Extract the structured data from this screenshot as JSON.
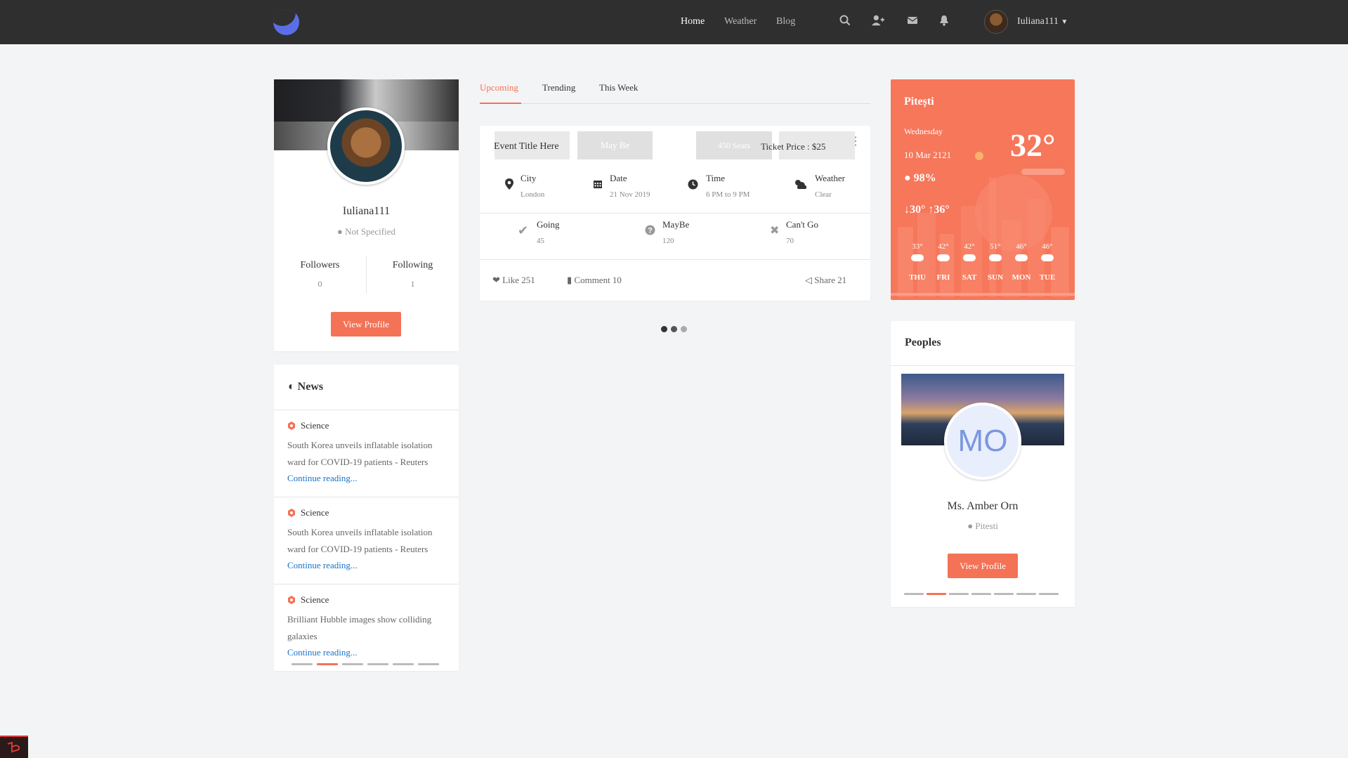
{
  "nav": {
    "links": [
      "Home",
      "Weather",
      "Blog"
    ],
    "user": "Iuliana111"
  },
  "profile": {
    "name": "Iuliana111",
    "location": "Not Specified",
    "followers_label": "Followers",
    "followers": "0",
    "following_label": "Following",
    "following": "1",
    "button": "View Profile"
  },
  "news": {
    "title": "News",
    "items": [
      {
        "category": "Science",
        "text": "South Korea unveils inflatable isolation ward for COVID-19 patients - Reuters",
        "link": "Continue reading..."
      },
      {
        "category": "Science",
        "text": "South Korea unveils inflatable isolation ward for COVID-19 patients - Reuters",
        "link": "Continue reading..."
      },
      {
        "category": "Science",
        "text": "Brilliant Hubble images show colliding galaxies",
        "link": "Continue reading..."
      }
    ],
    "active_dot": 1
  },
  "tabs": [
    "Upcoming",
    "Trending",
    "This Week"
  ],
  "event": {
    "title": "Event Title Here",
    "maybe_badge": "May Be",
    "seats": "450 Seats",
    "ticket": "Ticket Price : $25",
    "city_label": "City",
    "city": "London",
    "date_label": "Date",
    "date": "21 Nov 2019",
    "time_label": "Time",
    "time": "6 PM to 9 PM",
    "weather_label": "Weather",
    "weather": "Clear",
    "going_label": "Going",
    "going": "45",
    "maybe_label": "MayBe",
    "maybe": "120",
    "cantgo_label": "Can't Go",
    "cantgo": "70",
    "like": "Like 251",
    "comment": "Comment 10",
    "share": "Share 21"
  },
  "weather": {
    "city": "Pitești",
    "day": "Wednesday",
    "date": "10 Mar 2121",
    "humidity": "98%",
    "range": "30° ↑36°",
    "temp": "32°",
    "forecast": [
      {
        "day": "THU",
        "temp": "33°"
      },
      {
        "day": "FRI",
        "temp": "42°"
      },
      {
        "day": "SAT",
        "temp": "42°"
      },
      {
        "day": "SUN",
        "temp": "51°"
      },
      {
        "day": "MON",
        "temp": "46°"
      },
      {
        "day": "TUE",
        "temp": "46°"
      }
    ]
  },
  "peoples": {
    "title": "Peoples",
    "initials": "MO",
    "name": "Ms. Amber Orn",
    "location": "Pitesti",
    "button": "View Profile",
    "active_dot": 1
  },
  "colors": {
    "accent": "#f47256",
    "nav": "#2f2f2f",
    "link": "#1a73c9",
    "logo": "#5b6ee8"
  }
}
